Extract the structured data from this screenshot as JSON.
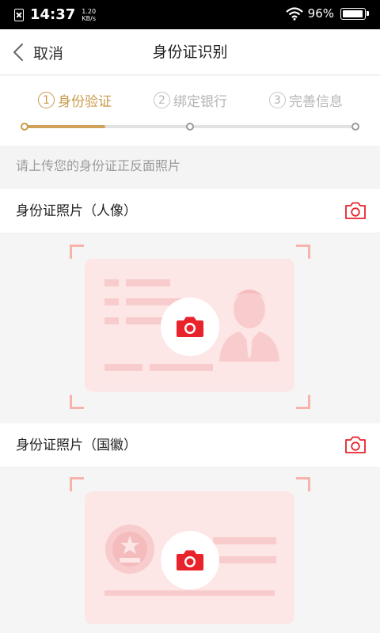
{
  "status_bar": {
    "time": "14:37",
    "net_speed_value": "1.20",
    "net_speed_unit": "KB/s",
    "battery_percent": "96%",
    "battery_level": 0.96
  },
  "nav": {
    "back_label": "取消",
    "title": "身份证识别"
  },
  "steps": [
    {
      "num": "1",
      "label": "身份验证",
      "active": true
    },
    {
      "num": "2",
      "label": "绑定银行",
      "active": false
    },
    {
      "num": "3",
      "label": "完善信息",
      "active": false
    }
  ],
  "progress": 0.245,
  "hint": "请上传您的身份证正反面照片",
  "sections": [
    {
      "title": "身份证照片（人像）"
    },
    {
      "title": "身份证照片（国徽）"
    }
  ],
  "colors": {
    "accent_gold": "#c99a4a",
    "camera_red": "#e8232c",
    "card_pink": "#fde6e6"
  },
  "icons": [
    "back-chevron-icon",
    "camera-icon",
    "wifi-icon",
    "battery-icon",
    "sim-icon"
  ]
}
